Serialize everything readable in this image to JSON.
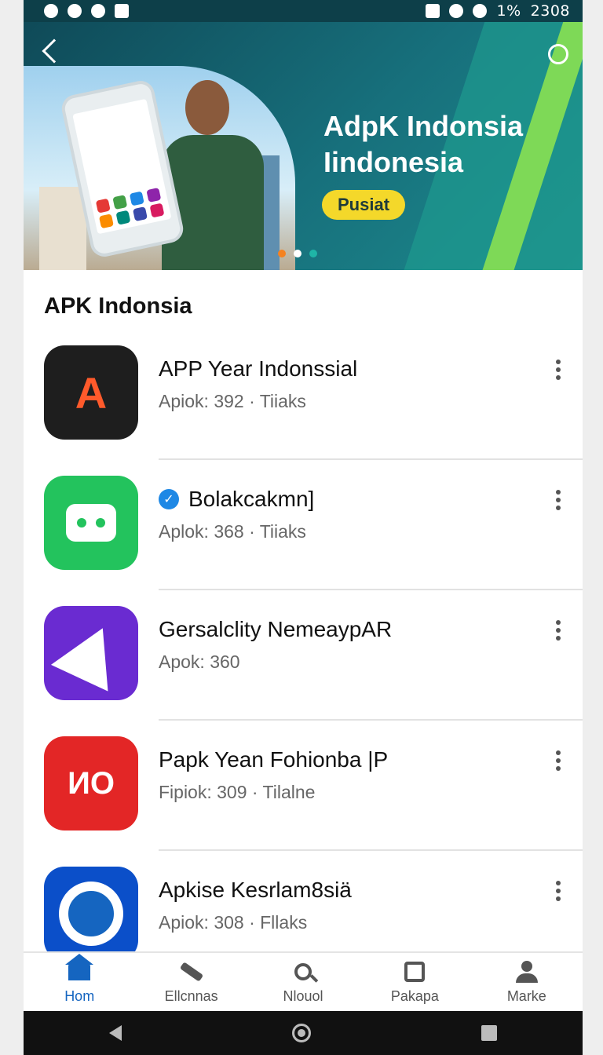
{
  "status_bar": {
    "battery": "1%",
    "time": "2308"
  },
  "banner": {
    "title_line1": "AdpK Indonsia",
    "title_line2": "Iindonesia",
    "button_label": "Pusiat",
    "page_count": 3,
    "active_page": 2
  },
  "section": {
    "title": "APK Indonsia"
  },
  "apps": [
    {
      "name": "APP Year Indonssial",
      "meta": "Apiok: 392 · Tiiaks",
      "verified": false,
      "icon": "ar-map-icon",
      "icon_text": "A",
      "color": "#1e1e1e"
    },
    {
      "name": "Bolakcakmn]",
      "meta": "Aplok: 368 · Tiiaks",
      "verified": true,
      "icon": "android-icon",
      "icon_text": "",
      "color": "#23c35d"
    },
    {
      "name": "Gersalclity NemeaypAR",
      "meta": "Apok: 360",
      "verified": false,
      "icon": "paper-plane-icon",
      "icon_text": "",
      "color": "#6a2bd1"
    },
    {
      "name": "Papk Yean Fohionba |P",
      "meta": "Fipiok: 309 · Tilalne",
      "verified": false,
      "icon": "cloud-logo-icon",
      "icon_text": "ИO",
      "color": "#e32626"
    },
    {
      "name": "Apkise Kesrlam8siä",
      "meta": "Apiok: 308 · Fllaks",
      "verified": false,
      "icon": "ring-logo-icon",
      "icon_text": "",
      "color": "#0b4fc9"
    }
  ],
  "bottom_nav": [
    {
      "label": "Hom",
      "icon": "home-icon",
      "active": true
    },
    {
      "label": "Ellcnnas",
      "icon": "plane-icon",
      "active": false
    },
    {
      "label": "Nlouol",
      "icon": "search-icon",
      "active": false
    },
    {
      "label": "Pakapa",
      "icon": "briefcase-icon",
      "active": false
    },
    {
      "label": "Marke",
      "icon": "person-icon",
      "active": false
    }
  ],
  "colors": {
    "status_bar": "#0d3f49",
    "banner": "#17707c",
    "accent_green": "#7ed957",
    "button_yellow": "#f4d82a",
    "active_nav": "#1565c0"
  }
}
